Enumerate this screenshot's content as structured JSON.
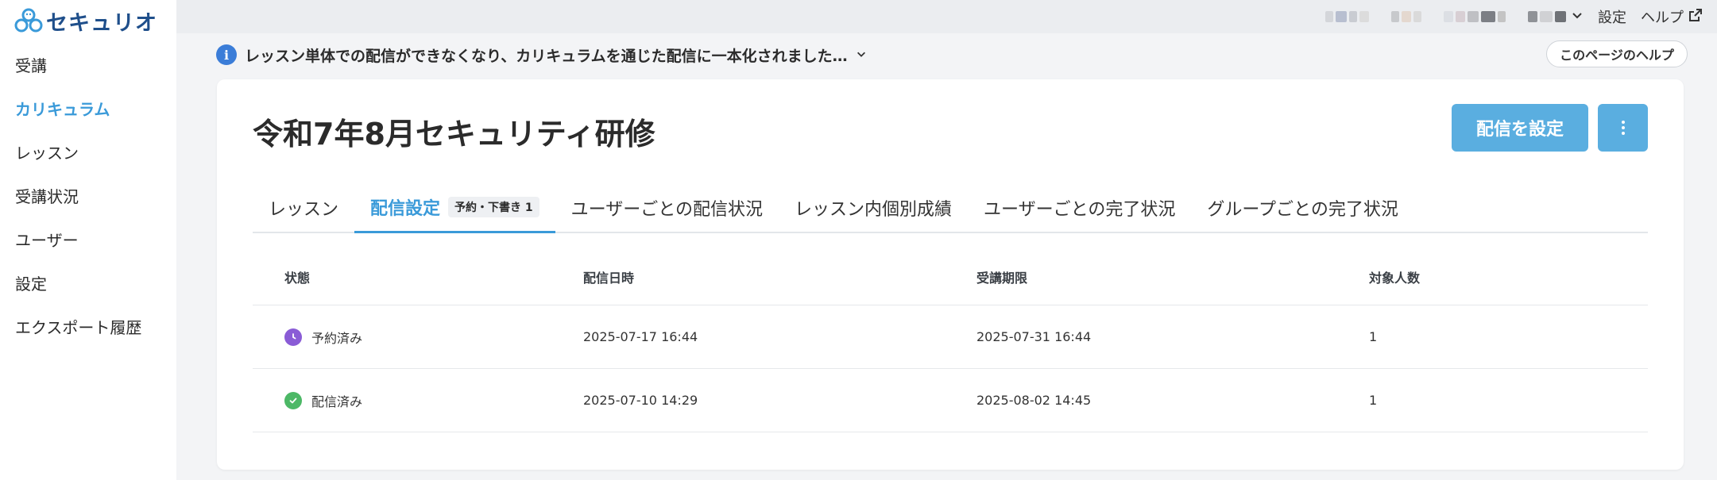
{
  "app": {
    "logo_text": "セキュリオ"
  },
  "sidebar": {
    "items": [
      {
        "label": "受講",
        "active": false
      },
      {
        "label": "カリキュラム",
        "active": true
      },
      {
        "label": "レッスン",
        "active": false
      },
      {
        "label": "受講状況",
        "active": false
      },
      {
        "label": "ユーザー",
        "active": false
      },
      {
        "label": "設定",
        "active": false
      },
      {
        "label": "エクスポート履歴",
        "active": false
      }
    ]
  },
  "topbar": {
    "settings_label": "設定",
    "help_label": "ヘルプ"
  },
  "notice": {
    "text": "レッスン単体での配信ができなくなり、カリキュラムを通じた配信に一本化されました…"
  },
  "page_help_label": "このページのヘルプ",
  "card": {
    "title": "令和7年8月セキュリティ研修",
    "primary_button": "配信を設定"
  },
  "tabs": [
    {
      "label": "レッスン",
      "active": false
    },
    {
      "label": "配信設定",
      "active": true,
      "badge": "予約・下書き 1"
    },
    {
      "label": "ユーザーごとの配信状況",
      "active": false
    },
    {
      "label": "レッスン内個別成績",
      "active": false
    },
    {
      "label": "ユーザーごとの完了状況",
      "active": false
    },
    {
      "label": "グループごとの完了状況",
      "active": false
    }
  ],
  "table": {
    "headers": [
      "状態",
      "配信日時",
      "受講期限",
      "対象人数"
    ],
    "rows": [
      {
        "status": "予約済み",
        "status_icon": "clock-icon",
        "status_color": "#8a5cd6",
        "delivered_at": "2025-07-17 16:44",
        "deadline": "2025-07-31 16:44",
        "count": "1"
      },
      {
        "status": "配信済み",
        "status_icon": "check-icon",
        "status_color": "#4cb866",
        "delivered_at": "2025-07-10 14:29",
        "deadline": "2025-08-02 14:45",
        "count": "1"
      }
    ]
  },
  "colors": {
    "accent": "#3a9ad9",
    "button": "#5aaee0",
    "info": "#3b7dd8"
  }
}
